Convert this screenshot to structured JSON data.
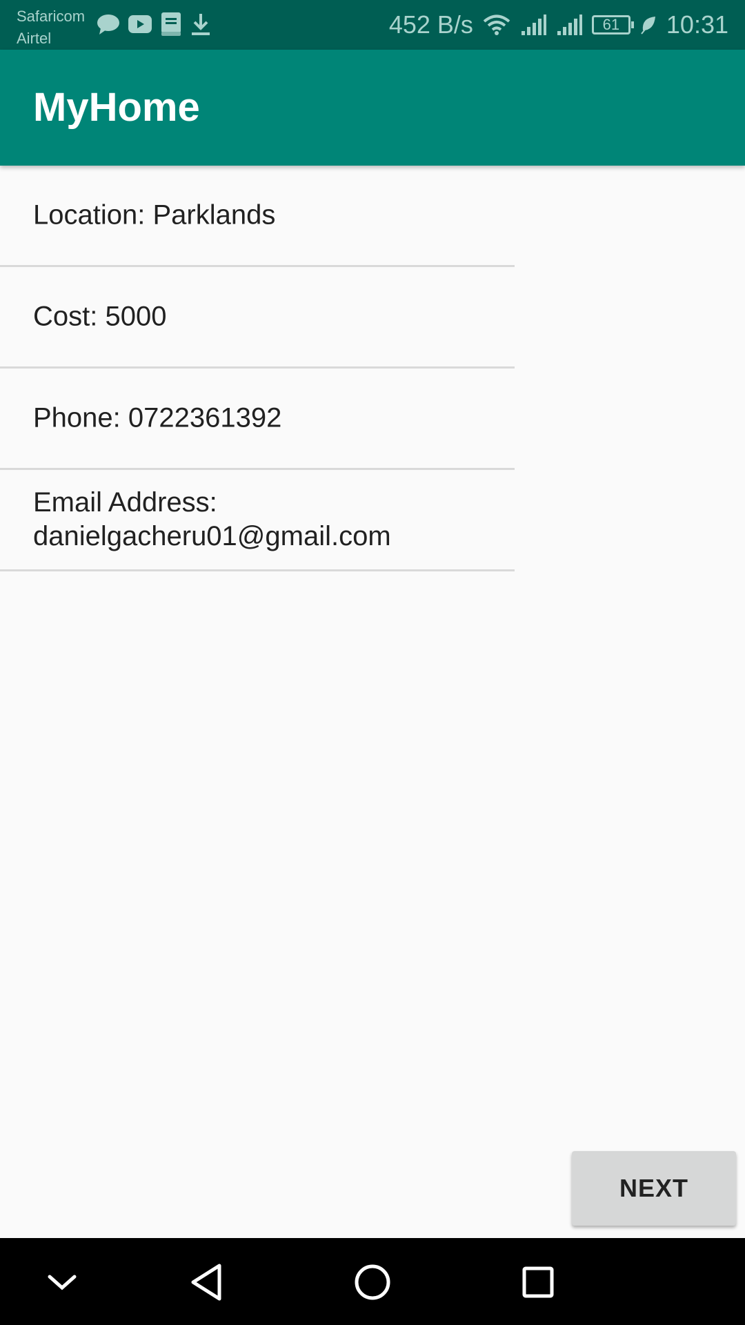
{
  "status_bar": {
    "carrier_1": "Safaricom",
    "carrier_2": "Airtel",
    "left_icons": [
      "chat-bubble-icon",
      "youtube-icon",
      "bible-app-icon",
      "download-icon"
    ],
    "net_speed": "452 B/s",
    "battery_level": "61",
    "time": "10:31"
  },
  "app_bar": {
    "title": "MyHome"
  },
  "details": [
    {
      "text": "Location: Parklands"
    },
    {
      "text": "Cost: 5000"
    },
    {
      "text": "Phone: 0722361392"
    },
    {
      "text": "Email Address: danielgacheru01@gmail.com"
    }
  ],
  "actions": {
    "next_label": "NEXT"
  },
  "colors": {
    "status_bar": "#005e53",
    "app_bar": "#008577",
    "background": "#fafafa",
    "button": "#d6d7d7",
    "nav_bar": "#000000"
  }
}
